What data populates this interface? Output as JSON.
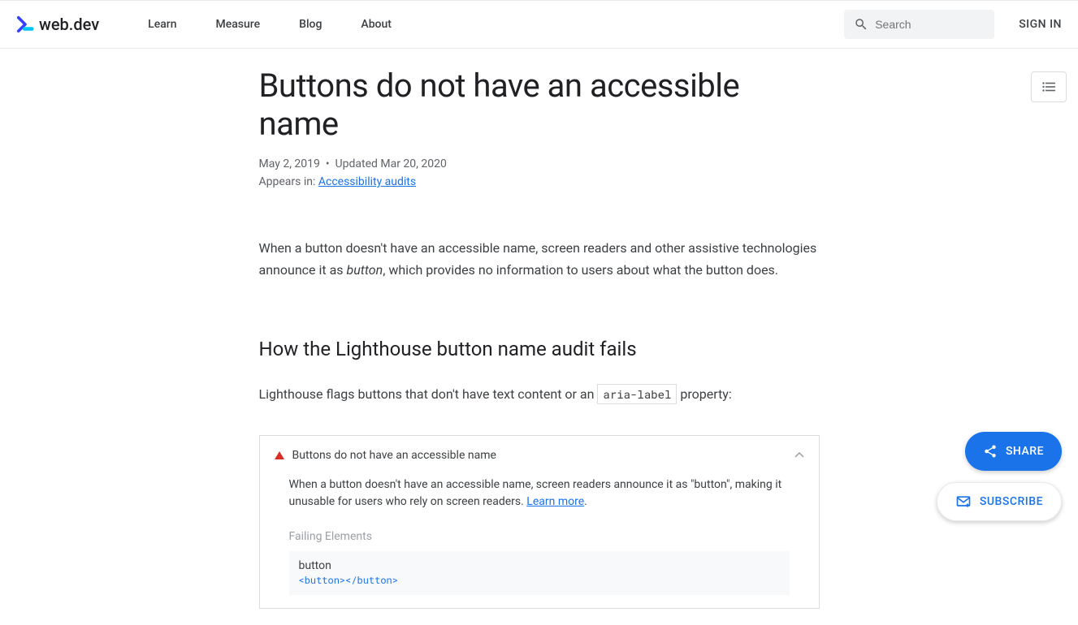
{
  "brand": {
    "text": "web.dev"
  },
  "nav": {
    "items": [
      "Learn",
      "Measure",
      "Blog",
      "About"
    ]
  },
  "header": {
    "search_placeholder": "Search",
    "signin": "SIGN IN"
  },
  "page": {
    "title": "Buttons do not have an accessible name",
    "date": "May 2, 2019",
    "updated": "Updated Mar 20, 2020",
    "appears_in_label": "Appears in:",
    "appears_in_link": "Accessibility audits",
    "intro_before": "When a button doesn't have an accessible name, screen readers and other assistive technologies announce it as ",
    "intro_italic": "button",
    "intro_after": ", which provides no information to users about what the button does.",
    "section_heading": "How the Lighthouse button name audit fails",
    "section_text_before": "Lighthouse flags buttons that don't have text content or an ",
    "section_code": "aria-label",
    "section_text_after": " property:"
  },
  "audit": {
    "title": "Buttons do not have an accessible name",
    "description": "When a button doesn't have an accessible name, screen readers announce it as \"button\", making it unusable for users who rely on screen readers. ",
    "learn_more": "Learn more",
    "period": ".",
    "failing_label": "Failing Elements",
    "failing_name": "button",
    "failing_code": "<button></button>"
  },
  "fab": {
    "share": "SHARE",
    "subscribe": "SUBSCRIBE"
  }
}
